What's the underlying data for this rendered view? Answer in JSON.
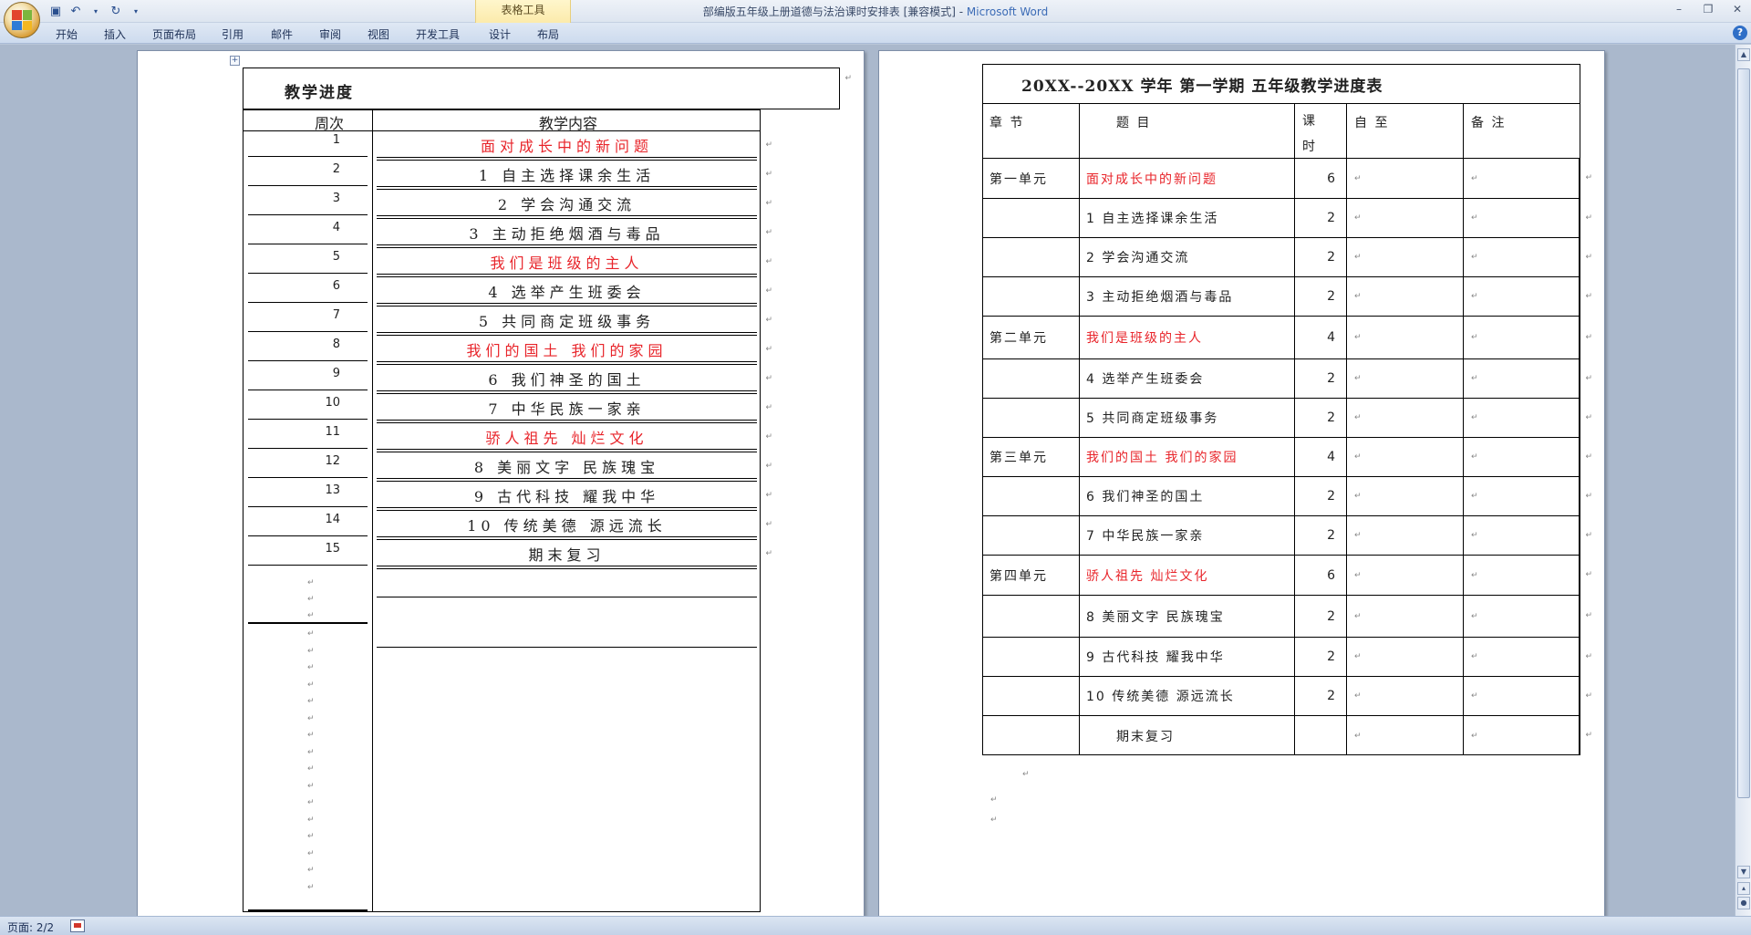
{
  "window": {
    "title": "部编版五年级上册道德与法治课时安排表 [兼容模式] - ",
    "app_name": "Microsoft Word"
  },
  "context_tab_label": "表格工具",
  "ribbon_tabs": [
    "开始",
    "插入",
    "页面布局",
    "引用",
    "邮件",
    "审阅",
    "视图",
    "开发工具",
    "设计",
    "布局"
  ],
  "page1": {
    "heading": "教学进度",
    "col_week": "周次",
    "col_content": "教学内容",
    "rows": [
      {
        "week": "1",
        "content": "面对成长中的新问题",
        "red": true
      },
      {
        "week": "2",
        "content": "1 自主选择课余生活",
        "red": false
      },
      {
        "week": "3",
        "content": "2 学会沟通交流",
        "red": false
      },
      {
        "week": "4",
        "content": "3 主动拒绝烟酒与毒品",
        "red": false
      },
      {
        "week": "5",
        "content": "我们是班级的主人",
        "red": true
      },
      {
        "week": "6",
        "content": "4 选举产生班委会",
        "red": false
      },
      {
        "week": "7",
        "content": "5 共同商定班级事务",
        "red": false
      },
      {
        "week": "8",
        "content": "我们的国土 我们的家园",
        "red": true
      },
      {
        "week": "9",
        "content": "6 我们神圣的国土",
        "red": false
      },
      {
        "week": "10",
        "content": "7 中华民族一家亲",
        "red": false
      },
      {
        "week": "11",
        "content": "骄人祖先 灿烂文化",
        "red": true
      },
      {
        "week": "12",
        "content": "8 美丽文字 民族瑰宝",
        "red": false
      },
      {
        "week": "13",
        "content": "9 古代科技 耀我中华",
        "red": false
      },
      {
        "week": "14",
        "content": "10 传统美德 源远流长",
        "red": false
      },
      {
        "week": "15",
        "content": "期末复习",
        "red": false
      }
    ]
  },
  "page2": {
    "title": "20XX--20XX 学年 第一学期  五年级教学进度表",
    "headers": {
      "chapter": "章 节",
      "topic": "题 目",
      "hours_1": "课",
      "hours_2": "时",
      "from_to": "自   至",
      "notes": "备   注"
    },
    "rows": [
      {
        "chapter": "第一单元",
        "topic": "面对成长中的新问题",
        "hours": "6",
        "red": true
      },
      {
        "chapter": "",
        "topic": "1 自主选择课余生活",
        "hours": "2",
        "red": false
      },
      {
        "chapter": "",
        "topic": "2 学会沟通交流",
        "hours": "2",
        "red": false
      },
      {
        "chapter": "",
        "topic": "3 主动拒绝烟酒与毒品",
        "hours": "2",
        "red": false
      },
      {
        "chapter": "第二单元",
        "topic": "我们是班级的主人",
        "hours": "4",
        "red": true
      },
      {
        "chapter": "",
        "topic": "4 选举产生班委会",
        "hours": "2",
        "red": false
      },
      {
        "chapter": "",
        "topic": "5 共同商定班级事务",
        "hours": "2",
        "red": false
      },
      {
        "chapter": "第三单元",
        "topic": "我们的国土 我们的家园",
        "hours": "4",
        "red": true
      },
      {
        "chapter": "",
        "topic": "6 我们神圣的国土",
        "hours": "2",
        "red": false
      },
      {
        "chapter": "",
        "topic": "7 中华民族一家亲",
        "hours": "2",
        "red": false
      },
      {
        "chapter": "第四单元",
        "topic": "骄人祖先 灿烂文化",
        "hours": "6",
        "red": true
      },
      {
        "chapter": "",
        "topic": "8 美丽文字 民族瑰宝",
        "hours": "2",
        "red": false
      },
      {
        "chapter": "",
        "topic": "9 古代科技 耀我中华",
        "hours": "2",
        "red": false
      },
      {
        "chapter": "",
        "topic": "10 传统美德 源远流长",
        "hours": "2",
        "red": false
      },
      {
        "chapter": "",
        "topic": "期末复习",
        "hours": "",
        "red": false
      }
    ]
  },
  "status": {
    "page": "页面: 2/2"
  },
  "colors": {
    "red_text": "#e8242a",
    "link_blue": "#3b6bb6"
  }
}
